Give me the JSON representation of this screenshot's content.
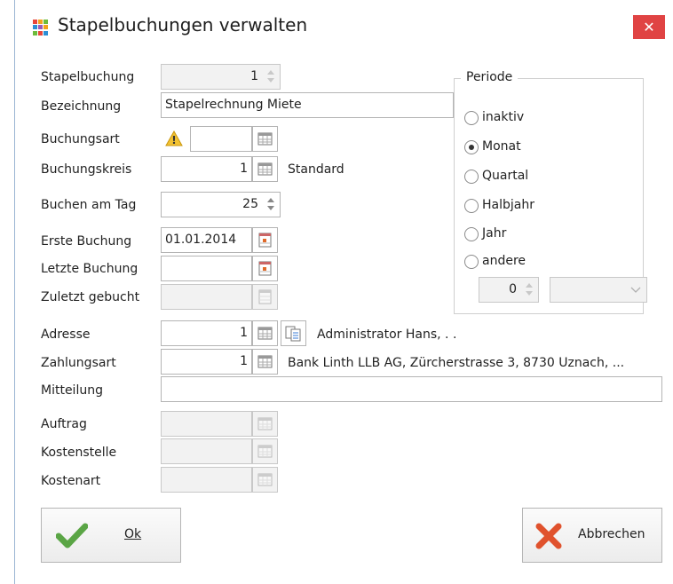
{
  "window": {
    "title": "Stapelbuchungen verwalten",
    "close_glyph": "✕"
  },
  "fields": {
    "stapelbuchung": {
      "label": "Stapelbuchung",
      "value": "1"
    },
    "bezeichnung": {
      "label": "Bezeichnung",
      "value": "Stapelrechnung Miete"
    },
    "buchungsart": {
      "label": "Buchungsart",
      "value": "",
      "warning": "!"
    },
    "buchungskreis": {
      "label": "Buchungskreis",
      "value": "1",
      "text": "Standard"
    },
    "buchen_am_tag": {
      "label": "Buchen am Tag",
      "value": "25"
    },
    "erste_buchung": {
      "label": "Erste Buchung",
      "value": "01.01.2014"
    },
    "letzte_buchung": {
      "label": "Letzte Buchung",
      "value": ""
    },
    "zuletzt_gebucht": {
      "label": "Zuletzt gebucht",
      "value": ""
    },
    "adresse": {
      "label": "Adresse",
      "value": "1",
      "text": "Administrator Hans, . ."
    },
    "zahlungsart": {
      "label": "Zahlungsart",
      "value": "1",
      "text": "Bank Linth LLB AG, Zürcherstrasse 3, 8730 Uznach, ..."
    },
    "mitteilung": {
      "label": "Mitteilung",
      "value": ""
    },
    "auftrag": {
      "label": "Auftrag",
      "value": ""
    },
    "kostenstelle": {
      "label": "Kostenstelle",
      "value": ""
    },
    "kostenart": {
      "label": "Kostenart",
      "value": ""
    }
  },
  "periode": {
    "title": "Periode",
    "options": [
      {
        "label": "inaktiv",
        "selected": false
      },
      {
        "label": "Monat",
        "selected": true
      },
      {
        "label": "Quartal",
        "selected": false
      },
      {
        "label": "Halbjahr",
        "selected": false
      },
      {
        "label": "Jahr",
        "selected": false
      },
      {
        "label": "andere",
        "selected": false
      }
    ],
    "andere_count": "0",
    "andere_unit": ""
  },
  "buttons": {
    "ok": "Ok",
    "cancel": "Abbrechen"
  },
  "colors": {
    "accent_check": "#4caf50",
    "cancel_x": "#e0522d",
    "close_bg": "#e04343"
  },
  "icons": [
    "app-grid-icon",
    "close-icon",
    "calendar-table-icon",
    "date-picker-icon",
    "warning-icon",
    "document-icon",
    "checkmark-icon",
    "cross-icon"
  ]
}
